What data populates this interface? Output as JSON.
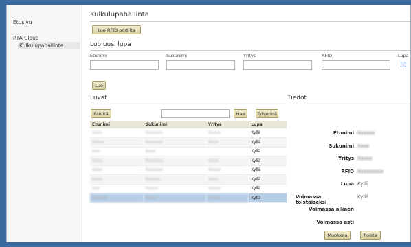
{
  "sidebar": {
    "home": "Etusivu",
    "cloud": "RTA Cloud",
    "sub": "Kulkulupahallinta"
  },
  "page": {
    "title": "Kulkulupahallinta",
    "read_rfid_button": "Lue RFID portilta"
  },
  "new_permit": {
    "title": "Luo uusi lupa",
    "labels": {
      "first_name": "Etunimi",
      "last_name": "Sukunimi",
      "company": "Yritys",
      "rfid": "RFID",
      "permit": "Lupa"
    },
    "create_button": "Luo"
  },
  "permits": {
    "title": "Luvat",
    "refresh_button": "Päivitä",
    "search_button": "Hae",
    "clear_button": "Tyhjennä",
    "columns": [
      "Etunimi",
      "Sukunimi",
      "Yritys",
      "Lupa"
    ],
    "rows": [
      {
        "first": "Xxxx",
        "last": "Xxxxxxx",
        "company": "Xxxxx",
        "permit": "Kyllä"
      },
      {
        "first": "Xxxxx",
        "last": "Xxxxxxx",
        "company": "Xxxx",
        "permit": "Kyllä"
      },
      {
        "first": "Xxx",
        "last": "Xxxx",
        "company": "",
        "permit": "Kyllä"
      },
      {
        "first": "Xxxx",
        "last": "Xxxxxxx",
        "company": "Xxxx",
        "permit": "Kyllä"
      },
      {
        "first": "Xxxx",
        "last": "Xxxxxxx",
        "company": "Xxxxx",
        "permit": "Kyllä"
      },
      {
        "first": "Xxxx",
        "last": "Xxxxxx",
        "company": "Xxxx",
        "permit": "Kyllä"
      },
      {
        "first": "Xxx",
        "last": "Xxxxx",
        "company": "Xxxxx",
        "permit": "Kyllä"
      },
      {
        "first": "Xxxxxx",
        "last": "Xxxxx",
        "company": "Xxxxx",
        "permit": "Kyllä"
      }
    ],
    "selected_index": 7
  },
  "details": {
    "title": "Tiedot",
    "rows": [
      {
        "label": "Etunimi",
        "value": "Xxxxxx"
      },
      {
        "label": "Sukunimi",
        "value": "Xxxx"
      },
      {
        "label": "Yritys",
        "value": "Xxxxx"
      },
      {
        "label": "RFID",
        "value": "Xxxxxxxxx"
      },
      {
        "label": "Lupa",
        "value": "Kyllä"
      },
      {
        "label": "Voimassa toistaiseksi",
        "value": "Kyllä"
      },
      {
        "label": "Voimassa alkaen",
        "value": ""
      },
      {
        "label": "Voimassa asti",
        "value": ""
      }
    ],
    "edit_button": "Muokkaa",
    "delete_button": "Poista"
  },
  "colors": {
    "background": "#3a6aa0",
    "button": "#d7cf9f",
    "selected_row": "#b6cde6"
  }
}
